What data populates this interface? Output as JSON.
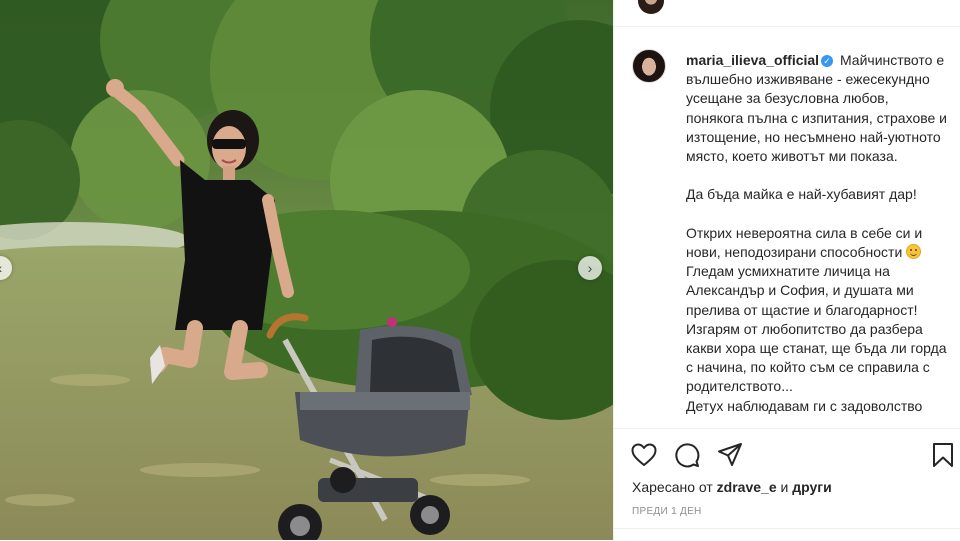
{
  "post": {
    "username": "maria_ilieva_official",
    "caption_1": " Майчинството е вълшебно изживяване - ежесекундно усещане за безусловна любов, понякога пълна с изпитания, страхове и изтощение, но несъмнено най-уютното място, което животът ми показа.\n\nДа бъда майка е най-хубавият дар!\n\nОткрих невероятна сила в себе си и нови, неподозирани способности ",
    "caption_2": " Гледам усмихнатите личица на Александър и София, и душата ми прелива от щастие и благодарност! Изгарям от любопитство да разбера какви хора ще станат, ще бъда ли горда с начина, по който съм се справила с родителството...\nДетух наблюдавам ги с задоволство",
    "liked_prefix": "Харесано от ",
    "liked_user": "zdrave_e",
    "liked_conj": " и ",
    "liked_others": "други",
    "timestamp": "ПРЕДИ 1 ДЕН"
  },
  "icons": {
    "verified": "verified-badge-icon",
    "like": "heart-icon",
    "comment": "comment-bubble-icon",
    "share": "paper-plane-icon",
    "save": "bookmark-icon",
    "emoji": "smiling-face-emoji",
    "prev": "chevron-left-icon",
    "next": "chevron-right-icon"
  },
  "colors": {
    "accent": "#3897f0",
    "text": "#262626",
    "muted": "#8e8e8e",
    "divider": "#efefef"
  }
}
